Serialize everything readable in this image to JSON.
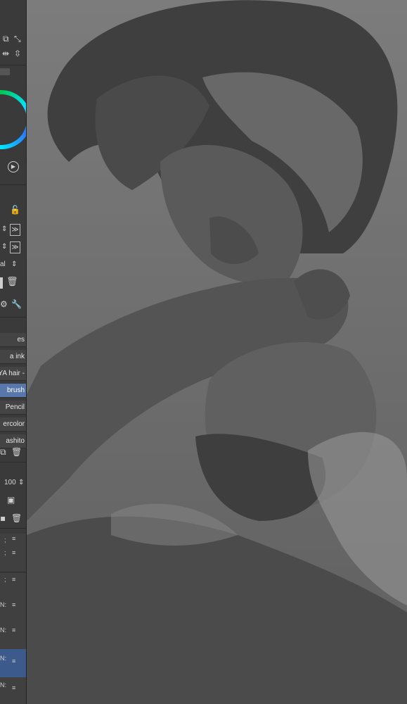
{
  "brush_list": [
    "es",
    "a ink",
    "YA hair -",
    "brush",
    "Pencil",
    "ercolor",
    "ashito"
  ],
  "brush_selected": 3,
  "blend_mode": "al",
  "opacity_value": "100",
  "layer_labels": [
    ";",
    ";",
    ";",
    "N:",
    "N:",
    "N:",
    "N:"
  ],
  "icons": {
    "toolbar": [
      "copy-icon",
      "fit-icon",
      "flip-horizontal-icon",
      "flip-vertical-icon"
    ],
    "play": "play-icon",
    "lock": "lock-icon",
    "trash": "trash-icon",
    "wrench": "wrench-icon",
    "menu": "hamburger-icon"
  },
  "colors": {
    "accent": "#5877ad",
    "panel": "#3a3a3a",
    "canvas": "#6e6e6e"
  }
}
